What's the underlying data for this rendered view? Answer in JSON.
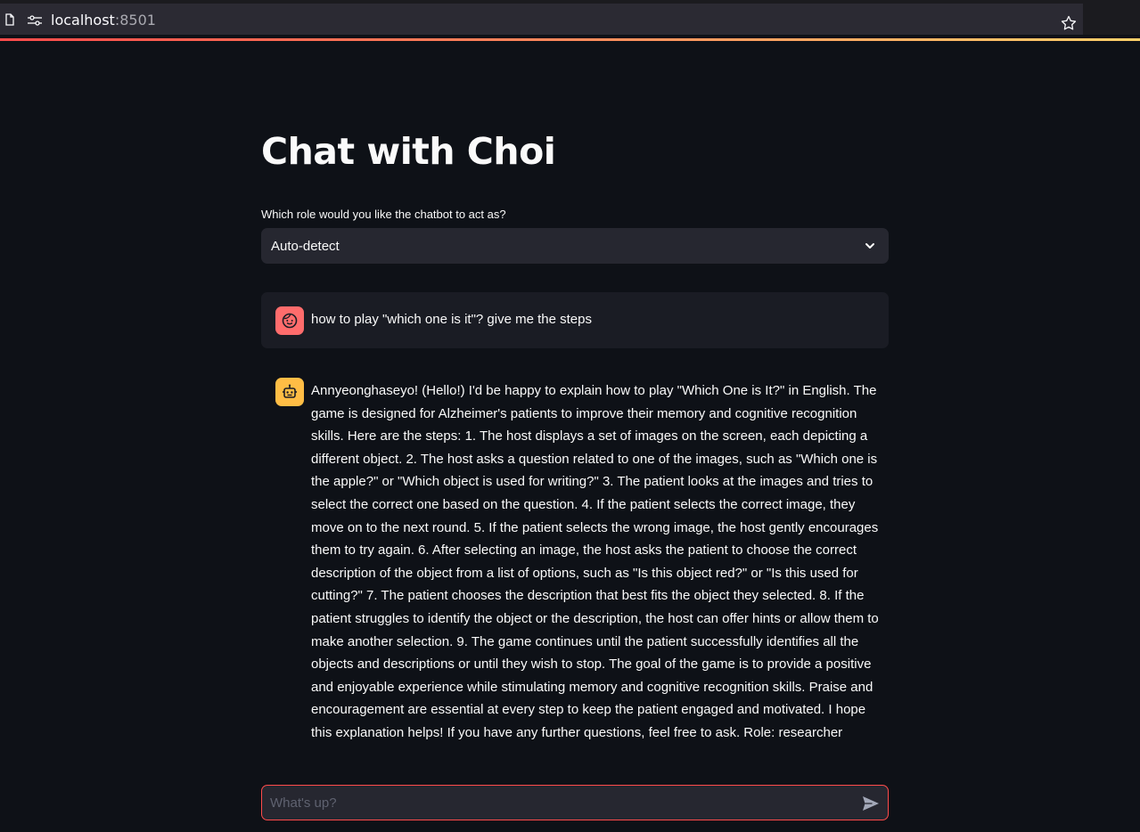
{
  "browser": {
    "url_host": "localhost",
    "url_port": ":8501"
  },
  "page": {
    "title": "Chat with Choi",
    "role_label": "Which role would you like the chatbot to act as?",
    "role_selected": "Auto-detect"
  },
  "messages": [
    {
      "role": "user",
      "text": "how to play \"which one is it\"? give me the steps"
    },
    {
      "role": "assistant",
      "text": "Annyeonghaseyo! (Hello!) I'd be happy to explain how to play \"Which One is It?\" in English. The game is designed for Alzheimer's patients to improve their memory and cognitive recognition skills. Here are the steps: 1. The host displays a set of images on the screen, each depicting a different object. 2. The host asks a question related to one of the images, such as \"Which one is the apple?\" or \"Which object is used for writing?\" 3. The patient looks at the images and tries to select the correct one based on the question. 4. If the patient selects the correct image, they move on to the next round. 5. If the patient selects the wrong image, the host gently encourages them to try again. 6. After selecting an image, the host asks the patient to choose the correct description of the object from a list of options, such as \"Is this object red?\" or \"Is this used for cutting?\" 7. The patient chooses the description that best fits the object they selected. 8. If the patient struggles to identify the object or the description, the host can offer hints or allow them to make another selection. 9. The game continues until the patient successfully identifies all the objects and descriptions or until they wish to stop. The goal of the game is to provide a positive and enjoyable experience while stimulating memory and cognitive recognition skills. Praise and encouragement are essential at every step to keep the patient engaged and motivated. I hope this explanation helps! If you have any further questions, feel free to ask. Role: researcher"
    }
  ],
  "chat_input": {
    "placeholder": "What's up?"
  },
  "colors": {
    "background": "#0e1117",
    "accent": "#ff4b4b",
    "user_avatar": "#ff6c6c",
    "bot_avatar": "#ffbd45"
  }
}
